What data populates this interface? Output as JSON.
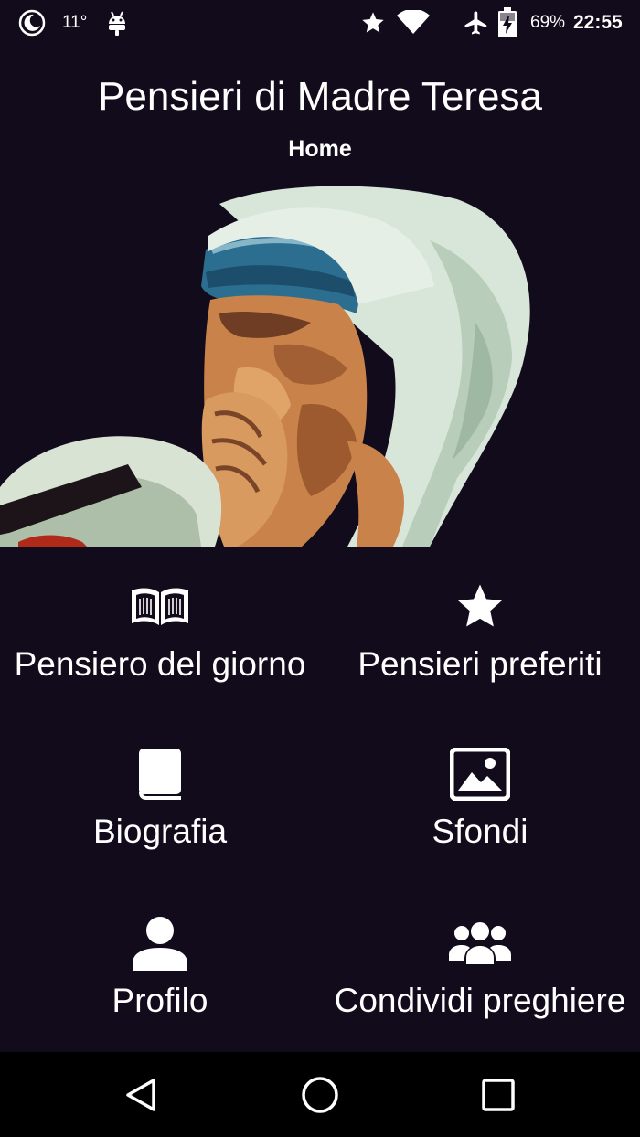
{
  "status_bar": {
    "temperature": "11°",
    "battery": "69%",
    "time": "22:55",
    "icons": [
      "moon-icon",
      "android-icon",
      "star-icon",
      "wifi-icon",
      "airplane-icon",
      "battery-charging-icon"
    ]
  },
  "header": {
    "title": "Pensieri di Madre Teresa",
    "subtitle": "Home"
  },
  "menu": {
    "items": [
      {
        "label": "Pensiero del giorno",
        "icon": "open-book-icon"
      },
      {
        "label": "Pensieri preferiti",
        "icon": "star-icon"
      },
      {
        "label": "Biografia",
        "icon": "book-icon"
      },
      {
        "label": "Sfondi",
        "icon": "image-icon"
      },
      {
        "label": "Profilo",
        "icon": "person-icon"
      },
      {
        "label": "Condividi preghiere",
        "icon": "group-icon"
      }
    ]
  },
  "navigation": {
    "buttons": [
      "back-icon",
      "home-icon",
      "recents-icon"
    ]
  },
  "colors": {
    "background": "#120b1b",
    "text": "#ffffff",
    "nav_bar": "#000000"
  }
}
